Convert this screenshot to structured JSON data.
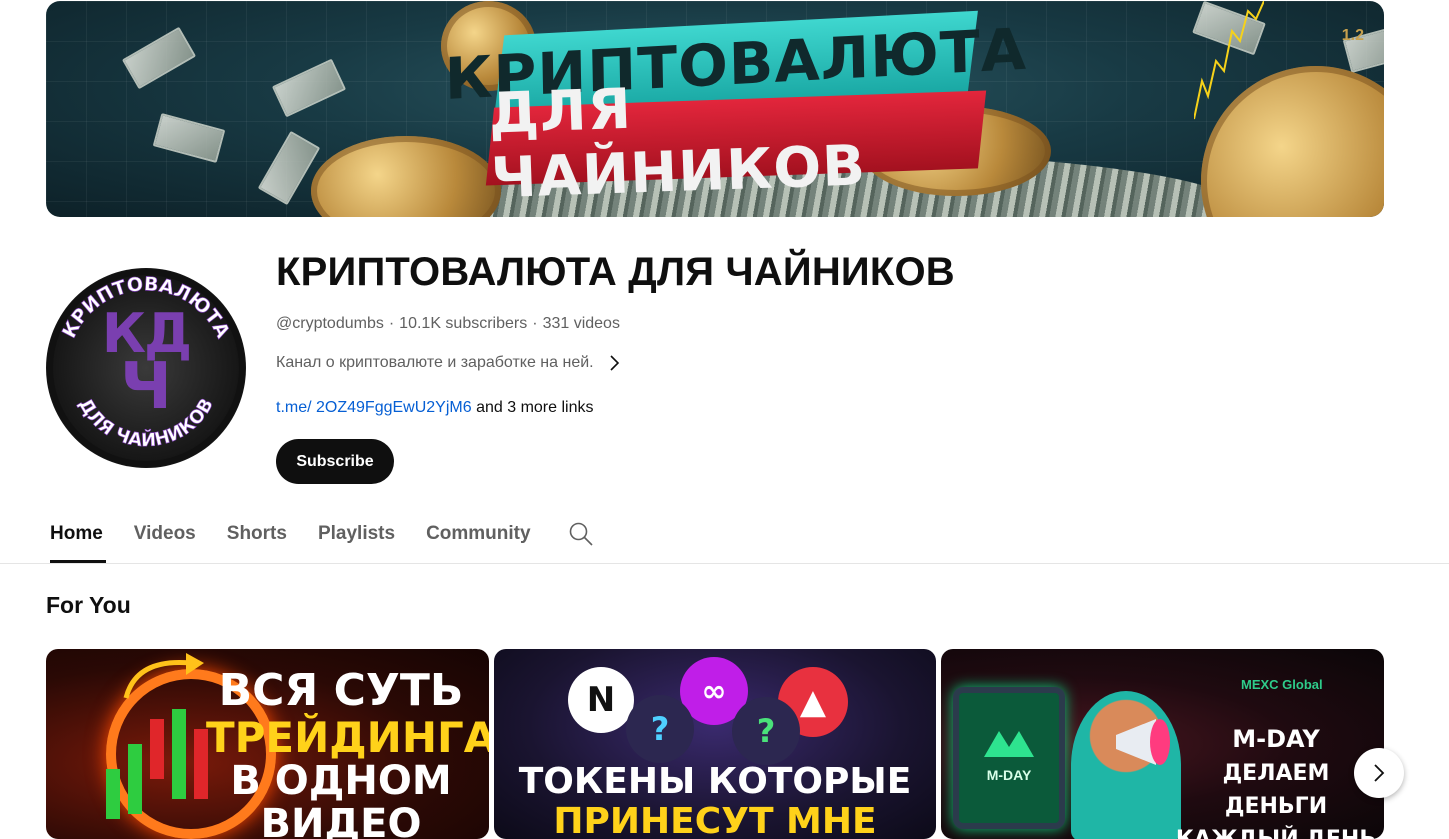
{
  "banner": {
    "title_line1": "КРИПТОВАЛЮТА",
    "title_line2": "ДЛЯ ЧАЙНИКОВ",
    "corner_number": "1.2"
  },
  "channel": {
    "avatar_monogram_top": "КД",
    "avatar_monogram_bottom": "Ч",
    "avatar_ring_top": "КРИПТОВАЛЮТА",
    "avatar_ring_bottom": "ДЛЯ ЧАЙНИКОВ",
    "name": "КРИПТОВАЛЮТА ДЛЯ ЧАЙНИКОВ",
    "handle": "@cryptodumbs",
    "subscribers": "10.1K subscribers",
    "videos": "331 videos",
    "separator": "·",
    "description": "Канал о криптовалюте и заработке на ней.",
    "link_text": "t.me/ 2OZ49FggEwU2YjM6",
    "more_links": "and 3 more links",
    "subscribe_label": "Subscribe"
  },
  "tabs": [
    {
      "label": "Home",
      "active": true
    },
    {
      "label": "Videos",
      "active": false
    },
    {
      "label": "Shorts",
      "active": false
    },
    {
      "label": "Playlists",
      "active": false
    },
    {
      "label": "Community",
      "active": false
    }
  ],
  "for_you": {
    "title": "For You",
    "videos": [
      {
        "thumb_lines": [
          "ВСЯ СУТЬ",
          "ТРЕЙДИНГА",
          "В ОДНОМ",
          "ВИДЕО"
        ]
      },
      {
        "thumb_lines": [
          "ТОКЕНЫ КОТОРЫЕ",
          "ПРИНЕСУТ МНЕ"
        ],
        "token_marks": [
          "?",
          "?"
        ]
      },
      {
        "brand": "MEXC Global",
        "tablet_label": "M-DAY",
        "thumb_lines": [
          "M-DAY",
          "ДЕЛАЕМ ДЕНЬГИ",
          "КАЖДЫЙ ДЕНЬ"
        ]
      }
    ]
  },
  "colors": {
    "link": "#065fd4",
    "subscribe_bg": "#0f0f0f",
    "muted_text": "#606060",
    "banner_teal": "#3fd7cf",
    "banner_red": "#e3263c",
    "thumb_yellow": "#ffd21a"
  },
  "icons": {
    "tab_search": "search-icon",
    "description_more": "chevron-right-icon",
    "carousel_next": "chevron-right-icon"
  }
}
